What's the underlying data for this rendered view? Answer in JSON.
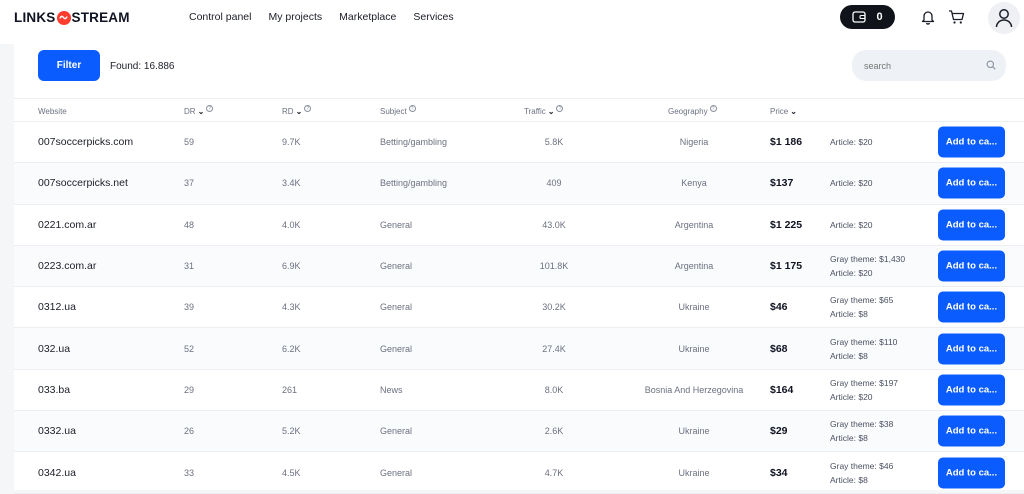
{
  "brand": {
    "left": "LINKS",
    "right": "STREAM",
    "accent": "#ff3d2e"
  },
  "nav": [
    {
      "label": "Control panel"
    },
    {
      "label": "My projects"
    },
    {
      "label": "Marketplace"
    },
    {
      "label": "Services"
    }
  ],
  "wallet": {
    "balance": "0",
    "icon": "wallet-icon"
  },
  "header_icons": [
    "bell-icon",
    "cart-icon",
    "user-icon"
  ],
  "toolbar": {
    "filter_label": "Filter",
    "found_text": "Found: 16.886",
    "search_placeholder": "search"
  },
  "columns": [
    {
      "label": "Website",
      "sort": false,
      "info": false
    },
    {
      "label": "DR",
      "sort": true,
      "info": true
    },
    {
      "label": "RD",
      "sort": true,
      "info": true
    },
    {
      "label": "Subject",
      "sort": false,
      "info": true
    },
    {
      "label": "Traffic",
      "sort": true,
      "info": true
    },
    {
      "label": "Geography",
      "sort": false,
      "info": true
    },
    {
      "label": "Price",
      "sort": true,
      "info": false
    }
  ],
  "add_button_label": "Add to ca...",
  "accent_color": "#0b5cff",
  "rows": [
    {
      "site": "007soccerpicks.com",
      "dr": "59",
      "rd": "9.7K",
      "subject": "Betting/gambling",
      "traffic": "5.8K",
      "geo": "Nigeria",
      "price": "$1 186",
      "extra1": "Article: $20",
      "extra2": ""
    },
    {
      "site": "007soccerpicks.net",
      "dr": "37",
      "rd": "3.4K",
      "subject": "Betting/gambling",
      "traffic": "409",
      "geo": "Kenya",
      "price": "$137",
      "extra1": "Article: $20",
      "extra2": ""
    },
    {
      "site": "0221.com.ar",
      "dr": "48",
      "rd": "4.0K",
      "subject": "General",
      "traffic": "43.0K",
      "geo": "Argentina",
      "price": "$1 225",
      "extra1": "Article: $20",
      "extra2": ""
    },
    {
      "site": "0223.com.ar",
      "dr": "31",
      "rd": "6.9K",
      "subject": "General",
      "traffic": "101.8K",
      "geo": "Argentina",
      "price": "$1 175",
      "extra1": "Gray theme: $1,430",
      "extra2": "Article: $20"
    },
    {
      "site": "0312.ua",
      "dr": "39",
      "rd": "4.3K",
      "subject": "General",
      "traffic": "30.2K",
      "geo": "Ukraine",
      "price": "$46",
      "extra1": "Gray theme: $65",
      "extra2": "Article: $8"
    },
    {
      "site": "032.ua",
      "dr": "52",
      "rd": "6.2K",
      "subject": "General",
      "traffic": "27.4K",
      "geo": "Ukraine",
      "price": "$68",
      "extra1": "Gray theme: $110",
      "extra2": "Article: $8"
    },
    {
      "site": "033.ba",
      "dr": "29",
      "rd": "261",
      "subject": "News",
      "traffic": "8.0K",
      "geo": "Bosnia And Herzegovina",
      "price": "$164",
      "extra1": "Gray theme: $197",
      "extra2": "Article: $20"
    },
    {
      "site": "0332.ua",
      "dr": "26",
      "rd": "5.2K",
      "subject": "General",
      "traffic": "2.6K",
      "geo": "Ukraine",
      "price": "$29",
      "extra1": "Gray theme: $38",
      "extra2": "Article: $8"
    },
    {
      "site": "0342.ua",
      "dr": "33",
      "rd": "4.5K",
      "subject": "General",
      "traffic": "4.7K",
      "geo": "Ukraine",
      "price": "$34",
      "extra1": "Gray theme: $46",
      "extra2": "Article: $8"
    }
  ]
}
